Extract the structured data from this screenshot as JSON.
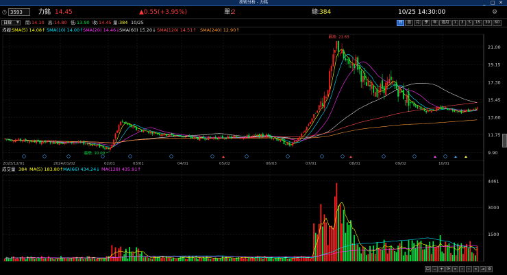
{
  "window": {
    "title": "技術分析 - 力銘",
    "controls": [
      "_",
      "□",
      "✕"
    ]
  },
  "info": {
    "code": "3593",
    "name": "力銘",
    "price": "14.45",
    "change": "▲0.55(+3.95%)",
    "single_label": "單:",
    "single": "2",
    "total_label": "總:",
    "total": "384",
    "datetime": "10/25 14:30:00"
  },
  "quote": {
    "period_select": "日線",
    "open_label": "開:",
    "open": "14.10",
    "high_label": "高:",
    "high": "14.80",
    "low_label": "低:",
    "low": "13.90",
    "close_label": "收:",
    "close": "14.45",
    "vol_label": "量:",
    "vol": "384",
    "date": "10/25",
    "periods": [
      "日",
      "週",
      "月",
      "季",
      "年",
      "週月",
      "1",
      "3",
      "5",
      "15",
      "30",
      "60"
    ]
  },
  "ma_line": {
    "prefix": "均線:",
    "items": [
      {
        "text": "SMA(5) 14.08↑",
        "color": "#ffff00"
      },
      {
        "text": "SMA(10) 14.00↑",
        "color": "#00e5ff"
      },
      {
        "text": "SMA(20) 14.46↓",
        "color": "#ff33ff"
      },
      {
        "text": "SMA(60) 15.20↓",
        "color": "#dddddd"
      },
      {
        "text": "SMA(120) 14.51↑",
        "color": "#ff4b4b"
      },
      {
        "text": "SMA(240) 12.90↑",
        "color": "#ff9933"
      }
    ]
  },
  "price_axis": [
    "21.00",
    "19.15",
    "17.30",
    "15.45",
    "13.60",
    "11.75",
    "9.90"
  ],
  "date_axis": [
    "2023/12/01",
    "2024/01/02",
    "02/01",
    "03/01",
    "04/01",
    "05/02",
    "06/03",
    "07/01",
    "08/01",
    "09/02",
    "10/01"
  ],
  "annotations": {
    "high": "最高: 21.65",
    "low": "最低: 10.00"
  },
  "volume": {
    "label": "成交量",
    "value": "384",
    "items": [
      {
        "text": "MA(5) 183.80↑",
        "color": "#ffff00"
      },
      {
        "text": "MA(66) 434.24↓",
        "color": "#00e5ff"
      },
      {
        "text": "MA(128) 435.91↑",
        "color": "#ff33ff"
      }
    ],
    "axis": [
      "4461",
      "3000",
      "1500"
    ]
  },
  "colors": {
    "up": "#ff2020",
    "down": "#00e640",
    "background": "#000000",
    "grid": "#2b2b2b"
  },
  "toolbar_icons": [
    "prev-page-icon",
    "zoom-out-icon",
    "zoom-in-icon",
    "refresh-icon",
    "rewind-icon",
    "back-icon",
    "forward-icon",
    "fast-forward-icon",
    "end-icon",
    "settings-icon"
  ]
}
